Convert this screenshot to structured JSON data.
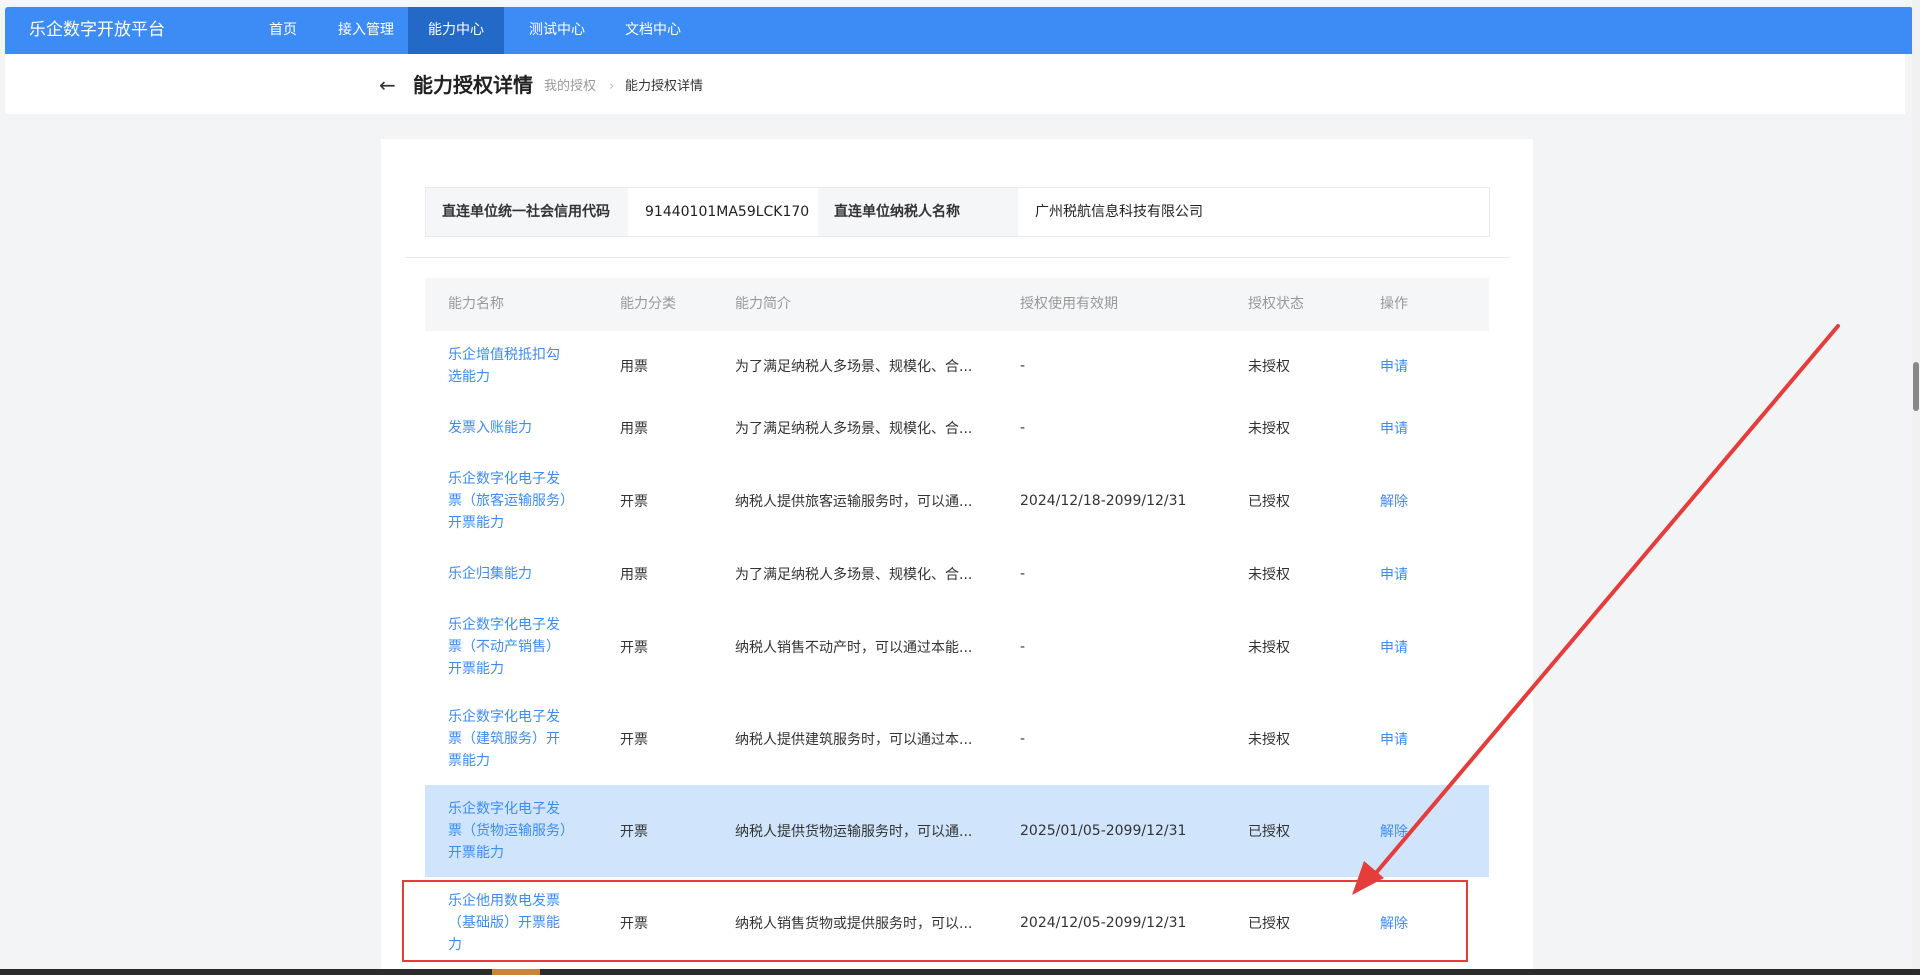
{
  "app": {
    "brand": "乐企数字开放平台"
  },
  "nav": [
    {
      "label": "首页",
      "active": false
    },
    {
      "label": "接入管理",
      "active": false
    },
    {
      "label": "能力中心",
      "active": true
    },
    {
      "label": "测试中心",
      "active": false
    },
    {
      "label": "文档中心",
      "active": false
    }
  ],
  "header": {
    "back_icon": "←",
    "title": "能力授权详情",
    "breadcrumb": [
      {
        "label": "我的授权"
      },
      {
        "label": "能力授权详情"
      }
    ],
    "breadcrumb_sep": "›"
  },
  "info": {
    "credit_code_label": "直连单位统一社会信用代码",
    "credit_code_value": "91440101MA59LCK170",
    "taxpayer_name_label": "直连单位纳税人名称",
    "taxpayer_name_value": "广州税航信息科技有限公司"
  },
  "table": {
    "columns": [
      "能力名称",
      "能力分类",
      "能力简介",
      "授权使用有效期",
      "授权状态",
      "操作"
    ],
    "rows": [
      {
        "name": "乐企增值税抵扣勾选能力",
        "category": "用票",
        "desc": "为了满足纳税人多场景、规模化、合...",
        "validity": "-",
        "status": "未授权",
        "action": "申请"
      },
      {
        "name": "发票入账能力",
        "category": "用票",
        "desc": "为了满足纳税人多场景、规模化、合...",
        "validity": "-",
        "status": "未授权",
        "action": "申请"
      },
      {
        "name": "乐企数字化电子发票（旅客运输服务）开票能力",
        "category": "开票",
        "desc": "纳税人提供旅客运输服务时，可以通...",
        "validity": "2024/12/18-2099/12/31",
        "status": "已授权",
        "action": "解除"
      },
      {
        "name": "乐企归集能力",
        "category": "用票",
        "desc": "为了满足纳税人多场景、规模化、合...",
        "validity": "-",
        "status": "未授权",
        "action": "申请"
      },
      {
        "name": "乐企数字化电子发票（不动产销售）开票能力",
        "category": "开票",
        "desc": "纳税人销售不动产时，可以通过本能...",
        "validity": "-",
        "status": "未授权",
        "action": "申请"
      },
      {
        "name": "乐企数字化电子发票（建筑服务）开票能力",
        "category": "开票",
        "desc": "纳税人提供建筑服务时，可以通过本...",
        "validity": "-",
        "status": "未授权",
        "action": "申请"
      },
      {
        "name": "乐企数字化电子发票（货物运输服务）开票能力",
        "category": "开票",
        "desc": "纳税人提供货物运输服务时，可以通...",
        "validity": "2025/01/05-2099/12/31",
        "status": "已授权",
        "action": "解除"
      },
      {
        "name": "乐企他用数电发票（基础版）开票能力",
        "category": "开票",
        "desc": "纳税人销售货物或提供服务时，可以...",
        "validity": "2024/12/05-2099/12/31",
        "status": "已授权",
        "action": "解除"
      }
    ]
  },
  "colors": {
    "primary": "#3d8cf5",
    "nav_active": "#2369c8",
    "highlight_row": "#d0e5fc",
    "annotation": "#e53c3c"
  }
}
